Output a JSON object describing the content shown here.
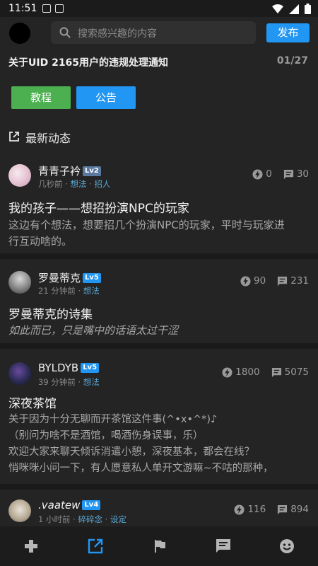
{
  "status": {
    "time": "11:51"
  },
  "header": {
    "search_placeholder": "搜索感兴趣的内容",
    "publish_label": "发布"
  },
  "notice": {
    "title": "关于UID 2165用户的违规处理通知",
    "counter": "01/27"
  },
  "buttons": {
    "tutorial": "教程",
    "announcement": "公告"
  },
  "section": {
    "title": "最新动态"
  },
  "posts": [
    {
      "user": "青青子衿",
      "level": "Lv2",
      "time": "几秒前",
      "tags": [
        "想法",
        "招人"
      ],
      "likes": "0",
      "comments": "30",
      "title": "我的孩子——想招扮演NPC的玩家",
      "body": [
        "这边有个想法，想要招几个扮演NPC的玩家，平时与玩家进",
        "行互动啥的。"
      ]
    },
    {
      "user": "罗曼蒂克",
      "level": "Lv5",
      "time": "21 分钟前",
      "tags": [
        "想法"
      ],
      "likes": "90",
      "comments": "231",
      "title": "罗曼蒂克的诗集",
      "body": [
        "如此而已，只是嘴中的话语太过干涩"
      ]
    },
    {
      "user": "BYLDYB",
      "level": "Lv5",
      "time": "39 分钟前",
      "tags": [
        "想法"
      ],
      "likes": "1800",
      "comments": "5075",
      "title": "深夜茶馆",
      "body": [
        "关于因为十分无聊而开茶馆这件事(^•x•^*)♪",
        "（别问为啥不是酒馆，喝酒伤身误事，乐）",
        "欢迎大家来聊天倾诉消遣小憩，深夜基本，都会在线？",
        "悄咪咪小问一下，有人愿意私人单开文游嘛~不咕的那种，"
      ]
    },
    {
      "user": ".vaatew",
      "level": "Lv4",
      "time": "1 小时前",
      "tags": [
        "碎碎念",
        "设定"
      ],
      "likes": "116",
      "comments": "894"
    }
  ],
  "colors": {
    "accent_blue": "#2196f3",
    "accent_green": "#4caf50",
    "tag": "#5aa9d6",
    "background": "#242424"
  },
  "nav": [
    "gamepad-icon",
    "edit-icon",
    "flag-icon",
    "message-icon",
    "face-icon"
  ]
}
